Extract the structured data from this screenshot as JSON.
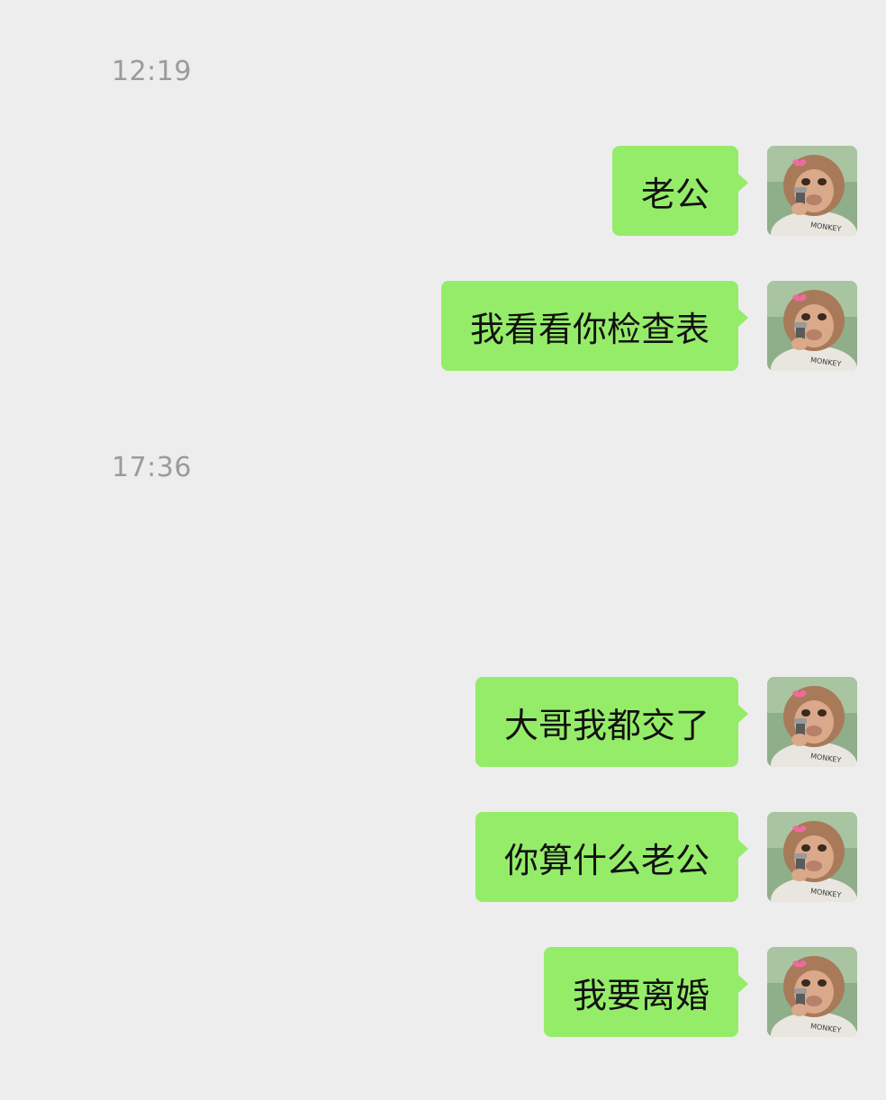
{
  "chat": {
    "timestamps": [
      "12:19",
      "17:36"
    ],
    "messages": [
      {
        "text": "老公"
      },
      {
        "text": "我看看你检查表"
      },
      {
        "text": "大哥我都交了"
      },
      {
        "text": "你算什么老公"
      },
      {
        "text": "我要离婚"
      }
    ],
    "avatar": {
      "icon": "monkey-with-gun-avatar",
      "shirt_text": "MONKEY"
    }
  },
  "colors": {
    "background": "#ededed",
    "bubble": "#95ec69",
    "timestamp": "#9b9b9b"
  }
}
